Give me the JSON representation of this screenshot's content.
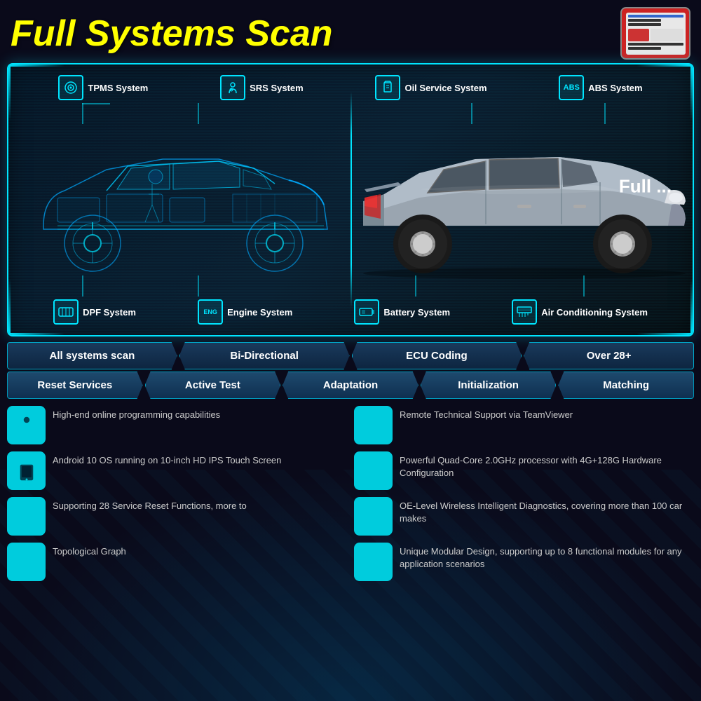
{
  "header": {
    "title": "Full Systems Scan"
  },
  "car_section": {
    "full_text": "Full ...",
    "systems_top": [
      {
        "icon": "⊙",
        "label": "TPMS System"
      },
      {
        "icon": "👤",
        "label": "SRS System"
      },
      {
        "icon": "🔒",
        "label": "Oil Service System"
      },
      {
        "icon": "ABS",
        "label": "ABS System"
      }
    ],
    "systems_bottom": [
      {
        "icon": "▭",
        "label": "DPF System"
      },
      {
        "icon": "ENG",
        "label": "Engine System"
      },
      {
        "icon": "▬",
        "label": "Battery System"
      },
      {
        "icon": "≡",
        "label": "Air Conditioning System"
      }
    ]
  },
  "nav_row1": {
    "tabs": [
      {
        "label": "All systems scan"
      },
      {
        "label": "Bi-Directional"
      },
      {
        "label": "ECU Coding"
      },
      {
        "label": "Over 28+"
      }
    ]
  },
  "nav_row2": {
    "tabs": [
      {
        "label": "Reset Services"
      },
      {
        "label": "Active Test"
      },
      {
        "label": "Adaptation"
      },
      {
        "label": "Initialization"
      },
      {
        "label": "Matching"
      }
    ]
  },
  "features": [
    {
      "icon": "🔧",
      "text": "High-end online programming capabilities"
    },
    {
      "icon": "⇄",
      "text": "Remote Technical Support via TeamViewer"
    },
    {
      "icon": "📱",
      "text": "Android 10 OS running on 10-inch HD IPS Touch Screen"
    },
    {
      "icon": "☢",
      "text": "Powerful Quad-Core 2.0GHz processor with 4G+128G Hardware Configuration"
    },
    {
      "icon": "🕐",
      "text": "Supporting 28 Service Reset Functions, more to"
    },
    {
      "icon": "〜",
      "text": "OE-Level Wireless Intelligent Diagnostics, covering more than 100 car makes"
    },
    {
      "icon": "⊞",
      "text": "Topological Graph"
    },
    {
      "icon": "◈",
      "text": "Unique Modular Design, supporting up to 8 functional modules for any application scenarios"
    }
  ]
}
